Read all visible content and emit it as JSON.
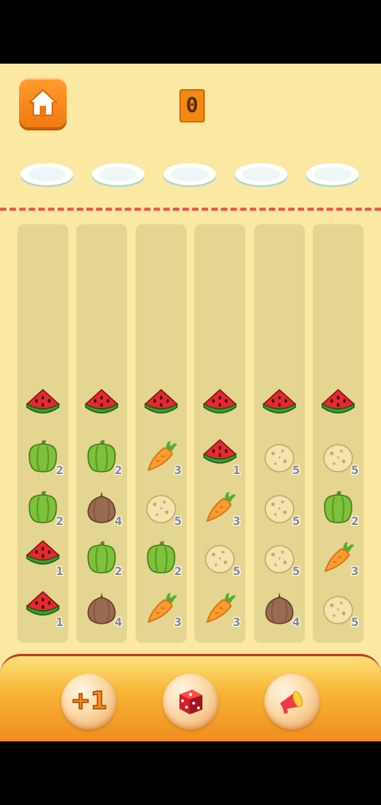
{
  "hud": {
    "score": "0",
    "home_icon": "house-icon"
  },
  "plates": [
    "empty",
    "empty",
    "empty",
    "empty",
    "empty"
  ],
  "columns": [
    [
      {
        "item": "watermelon",
        "count": ""
      },
      {
        "item": "pepper",
        "count": "2"
      },
      {
        "item": "pepper",
        "count": "2"
      },
      {
        "item": "watermelon",
        "count": "1"
      },
      {
        "item": "watermelon",
        "count": "1"
      }
    ],
    [
      {
        "item": "watermelon",
        "count": ""
      },
      {
        "item": "pepper",
        "count": "2"
      },
      {
        "item": "onion",
        "count": "4"
      },
      {
        "item": "pepper",
        "count": "2"
      },
      {
        "item": "onion",
        "count": "4"
      }
    ],
    [
      {
        "item": "watermelon",
        "count": ""
      },
      {
        "item": "carrot",
        "count": "3"
      },
      {
        "item": "potato",
        "count": "5"
      },
      {
        "item": "pepper",
        "count": "2"
      },
      {
        "item": "carrot",
        "count": "3"
      }
    ],
    [
      {
        "item": "watermelon",
        "count": ""
      },
      {
        "item": "watermelon",
        "count": "1"
      },
      {
        "item": "carrot",
        "count": "3"
      },
      {
        "item": "potato",
        "count": "5"
      },
      {
        "item": "carrot",
        "count": "3"
      }
    ],
    [
      {
        "item": "watermelon",
        "count": ""
      },
      {
        "item": "potato",
        "count": "5"
      },
      {
        "item": "potato",
        "count": "5"
      },
      {
        "item": "potato",
        "count": "5"
      },
      {
        "item": "onion",
        "count": "4"
      }
    ],
    [
      {
        "item": "watermelon",
        "count": ""
      },
      {
        "item": "potato",
        "count": "5"
      },
      {
        "item": "pepper",
        "count": "2"
      },
      {
        "item": "carrot",
        "count": "3"
      },
      {
        "item": "potato",
        "count": "5"
      }
    ]
  ],
  "powerups": {
    "add_slot_label": "+1",
    "shuffle_icon": "dice-icon",
    "hint_icon": "megaphone-icon"
  },
  "colors": {
    "background": "#fbe8a2",
    "column": "#e4d590",
    "dash_line": "#ec5a4e",
    "button": "#f07a10"
  }
}
